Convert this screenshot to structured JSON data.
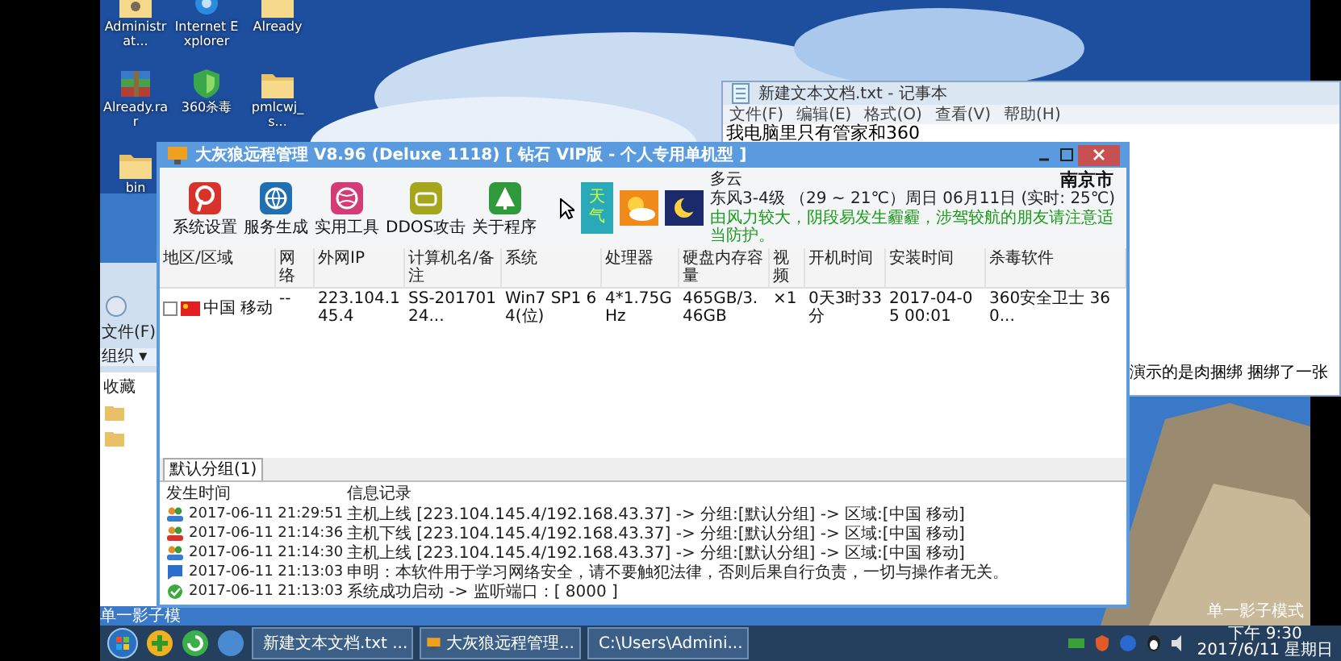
{
  "desktop_icons": [
    {
      "label": "Administrat...",
      "kind": "user-folder"
    },
    {
      "label": "Internet Explorer",
      "kind": "browser"
    },
    {
      "label": "Already",
      "kind": "folder"
    },
    {
      "label": "Already.rar",
      "kind": "archive"
    },
    {
      "label": "360杀毒",
      "kind": "shield"
    },
    {
      "label": "pmlcwj_s...",
      "kind": "folder"
    },
    {
      "label": "bin",
      "kind": "folder"
    }
  ],
  "notepad": {
    "title": "新建文本文档.txt - 记事本",
    "menu": [
      "文件(F)",
      "编辑(E)",
      "格式(O)",
      "查看(V)",
      "帮助(H)"
    ],
    "first_line": "我电脑里只有管家和360",
    "last_line": "演示的是肉捆绑 捆绑了一张"
  },
  "explorer": {
    "menu": "文件(F)",
    "toolbar": "组织 ▾",
    "nav": "收藏"
  },
  "wallpaper_captions": [
    "单一影子模",
    "单一影子模式"
  ],
  "main_window": {
    "title": "大灰狼远程管理 V8.96 (Deluxe 1118) [ 钻石 VIP版 - 个人专用单机型 ]",
    "toolbar": [
      {
        "label": "系统设置",
        "kind": "settings"
      },
      {
        "label": "服务生成",
        "kind": "generate"
      },
      {
        "label": "实用工具",
        "kind": "tools"
      },
      {
        "label": "DDOS攻击",
        "kind": "attack"
      },
      {
        "label": "关于程序",
        "kind": "about"
      }
    ],
    "weather": {
      "badge": "天气",
      "condition": "多云",
      "wind": "东风3-4级 （29 ~ 21℃）",
      "city": "南京市",
      "date": "周日 06月11日 (实时: 25℃)",
      "notice": "由风力较大，阴段易发生霾霾，涉驾较航的朋友请注意适当防护。"
    },
    "table": {
      "columns": [
        "地区/区域",
        "网络",
        "外网IP",
        "计算机名/备注",
        "系统",
        "处理器",
        "硬盘内存容量",
        "视频",
        "开机时间",
        "安装时间",
        "杀毒软件"
      ],
      "rows": [
        {
          "checked": false,
          "cells": [
            "中国 移动",
            "--",
            "223.104.145.4",
            "SS-20170124...",
            "Win7 SP1 64(位)",
            "4*1.75GHz",
            "465GB/3.46GB",
            "×1",
            "0天3时33分",
            "2017-04-05 00:01",
            "360安全卫士 360..."
          ]
        }
      ]
    },
    "tabs": [
      {
        "label": "默认分组(1)",
        "selected": true
      }
    ],
    "log": {
      "columns": [
        "发生时间",
        "信息记录"
      ],
      "rows": [
        {
          "kind": "online",
          "time": "2017-06-11 21:29:51",
          "message": "主机上线 [223.104.145.4/192.168.43.37] -> 分组:[默认分组] -> 区域:[中国 移动]"
        },
        {
          "kind": "offline",
          "time": "2017-06-11 21:14:36",
          "message": "主机下线 [223.104.145.4/192.168.43.37] -> 分组:[默认分组] -> 区域:[中国 移动]"
        },
        {
          "kind": "online",
          "time": "2017-06-11 21:14:30",
          "message": "主机上线 [223.104.145.4/192.168.43.37] -> 分组:[默认分组] -> 区域:[中国 移动]"
        },
        {
          "kind": "notice",
          "time": "2017-06-11 21:13:03",
          "message": "申明：本软件用于学习网络安全，请不要触犯法律，否则后果自行负责，一切与操作者无关。"
        },
        {
          "kind": "ok",
          "time": "2017-06-11 21:13:03",
          "message": "系统成功启动 -> 监听端口：[ 8000 ]"
        }
      ]
    }
  },
  "taskbar": {
    "items": [
      {
        "label": "新建文本文档.txt ...",
        "kind": "notepad"
      },
      {
        "label": "大灰狼远程管理...",
        "kind": "monitor"
      },
      {
        "label": "C:\\Users\\Admini...",
        "kind": "folder"
      }
    ],
    "time": "下午 9:30",
    "date": "2017/6/11 星期日"
  }
}
